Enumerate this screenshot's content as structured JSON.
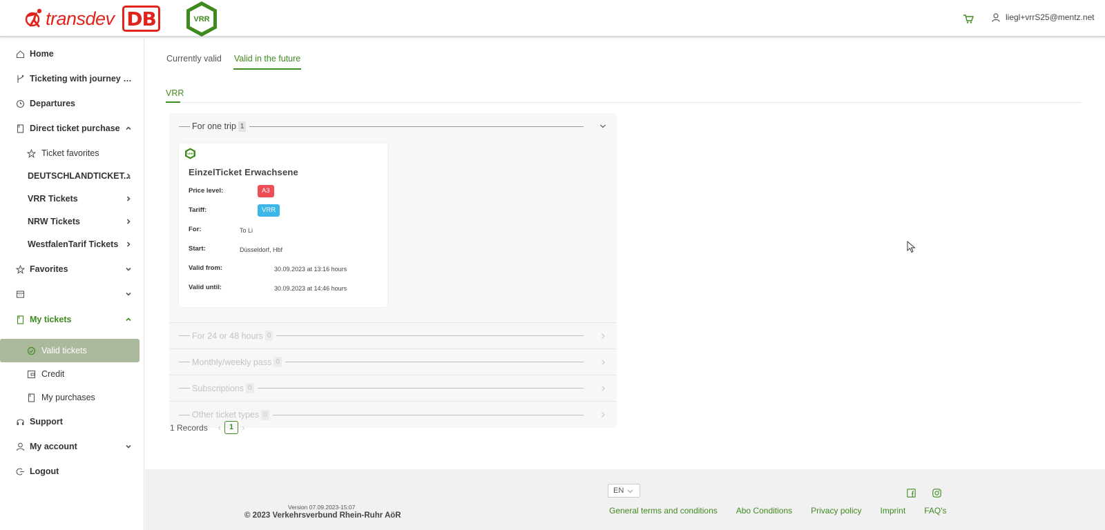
{
  "header": {
    "logo_transdev": "transdev",
    "logo_db": "DB",
    "logo_vrr": "VRR",
    "cart_icon": "cart-icon",
    "user_email": "liegl+vrrS25@mentz.net"
  },
  "sidebar": {
    "items": [
      {
        "label": "Home",
        "icon": "home-icon"
      },
      {
        "label": "Ticketing with journey pl...",
        "icon": "route-icon"
      },
      {
        "label": "Departures",
        "icon": "clock-icon"
      },
      {
        "label": "Direct ticket purchase",
        "icon": "ticket-icon"
      },
      {
        "label": "Ticket favorites",
        "icon": "star-icon"
      },
      {
        "label": "DEUTSCHLANDTICKET..."
      },
      {
        "label": "VRR Tickets"
      },
      {
        "label": "NRW Tickets"
      },
      {
        "label": "WestfalenTarif Tickets"
      },
      {
        "label": "Favorites",
        "icon": "star-icon"
      },
      {
        "label": "",
        "icon": "calculator-icon"
      },
      {
        "label": "My tickets",
        "icon": "ticket-icon"
      },
      {
        "label": "Valid tickets",
        "icon": "check-circle-icon"
      },
      {
        "label": "Credit",
        "icon": "wallet-icon"
      },
      {
        "label": "My purchases",
        "icon": "receipt-icon"
      },
      {
        "label": "Support",
        "icon": "headset-icon"
      },
      {
        "label": "My account",
        "icon": "user-icon"
      },
      {
        "label": "Logout",
        "icon": "logout-icon"
      }
    ]
  },
  "main": {
    "tabs": [
      {
        "label": "Currently valid"
      },
      {
        "label": "Valid in the future"
      }
    ],
    "sub_tab": "VRR",
    "sections": [
      {
        "title": "For one trip",
        "count": "1"
      },
      {
        "title": "For 24 or 48 hours",
        "count": "0"
      },
      {
        "title": "Monthly/weekly pass",
        "count": "0"
      },
      {
        "title": "Subscriptions",
        "count": "0"
      },
      {
        "title": "Other ticket types",
        "count": "0"
      }
    ],
    "ticket": {
      "logo": "VRR",
      "name": "EinzelTicket Erwachsene",
      "price_level_label": "Price level:",
      "price_level": "A3",
      "tariff_label": "Tariff:",
      "tariff": "VRR",
      "for_label": "For:",
      "for_value": "To Li",
      "start_label": "Start:",
      "start_value": "Düsseldorf, Hbf",
      "valid_from_label": "Valid from:",
      "valid_from": "30.09.2023 at 13:16 hours",
      "valid_until_label": "Valid until:",
      "valid_until": "30.09.2023 at 14:46 hours",
      "colors": {
        "price_level": "#ef4d55",
        "tariff": "#3db6e8"
      }
    },
    "records": "1 Records",
    "page": "1"
  },
  "footer": {
    "language": "EN",
    "version": "Version 07.09.2023-15:07",
    "copyright": "© 2023 Verkehrsverbund Rhein-Ruhr AöR",
    "links": [
      "General terms and conditions",
      "Abo Conditions",
      "Privacy policy",
      "Imprint",
      "FAQ's"
    ],
    "social": [
      "facebook-icon",
      "instagram-icon"
    ]
  },
  "colors": {
    "accent": "#3f8a1e",
    "active_nav": "#aab89b",
    "brand_red": "#e0241b"
  }
}
